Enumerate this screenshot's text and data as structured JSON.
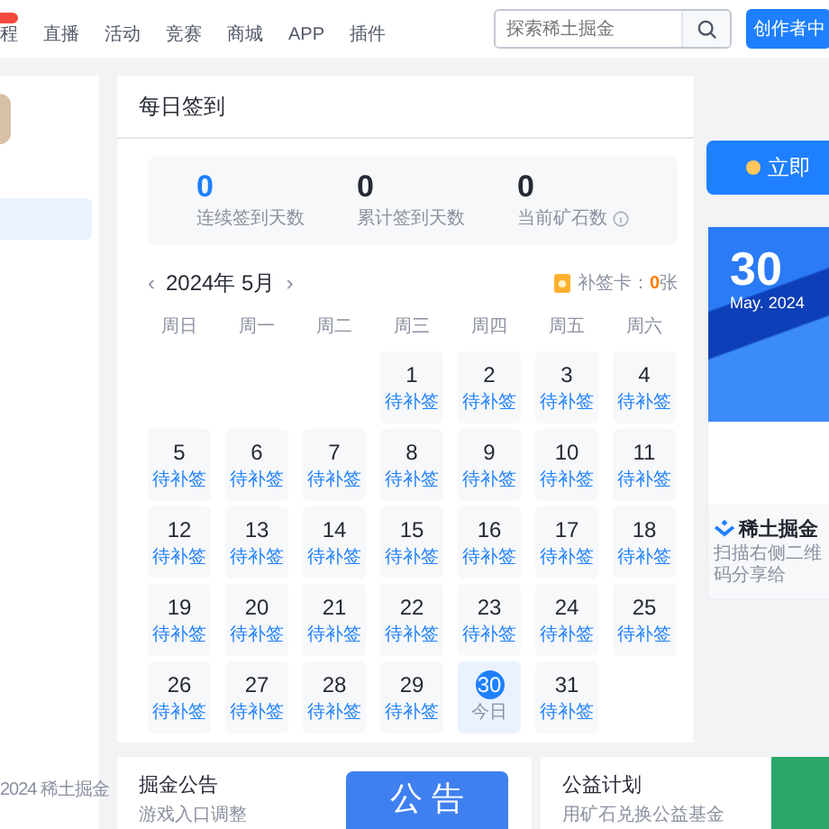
{
  "header": {
    "nav": [
      {
        "label": "程",
        "badge": true
      },
      {
        "label": "直播",
        "badge": false
      },
      {
        "label": "活动",
        "badge": false
      },
      {
        "label": "竞赛",
        "badge": false
      },
      {
        "label": "商城",
        "badge": false
      },
      {
        "label": "APP",
        "badge": false
      },
      {
        "label": "插件",
        "badge": false
      }
    ],
    "search": {
      "placeholder": "探索稀土掘金"
    },
    "creator_button": "创作者中"
  },
  "sidebar": {
    "footer": "2024 稀土掘金"
  },
  "checkin": {
    "title": "每日签到",
    "stats": [
      {
        "value": "0",
        "label": "连续签到天数",
        "highlight": true,
        "info": false
      },
      {
        "value": "0",
        "label": "累计签到天数",
        "highlight": false,
        "info": false
      },
      {
        "value": "0",
        "label": "当前矿石数",
        "highlight": false,
        "info": true
      }
    ],
    "prev": "‹",
    "month": "2024年 5月",
    "next": "›",
    "card_label": "补签卡：",
    "card_count": "0",
    "card_unit": "张",
    "weekdays": [
      "周日",
      "周一",
      "周二",
      "周三",
      "周四",
      "周五",
      "周六"
    ],
    "days": [
      {
        "kind": "blank"
      },
      {
        "kind": "blank"
      },
      {
        "kind": "blank"
      },
      {
        "kind": "day",
        "day": "1",
        "status": "待补签",
        "today": false
      },
      {
        "kind": "day",
        "day": "2",
        "status": "待补签",
        "today": false
      },
      {
        "kind": "day",
        "day": "3",
        "status": "待补签",
        "today": false
      },
      {
        "kind": "day",
        "day": "4",
        "status": "待补签",
        "today": false
      },
      {
        "kind": "day",
        "day": "5",
        "status": "待补签",
        "today": false
      },
      {
        "kind": "day",
        "day": "6",
        "status": "待补签",
        "today": false
      },
      {
        "kind": "day",
        "day": "7",
        "status": "待补签",
        "today": false
      },
      {
        "kind": "day",
        "day": "8",
        "status": "待补签",
        "today": false
      },
      {
        "kind": "day",
        "day": "9",
        "status": "待补签",
        "today": false
      },
      {
        "kind": "day",
        "day": "10",
        "status": "待补签",
        "today": false
      },
      {
        "kind": "day",
        "day": "11",
        "status": "待补签",
        "today": false
      },
      {
        "kind": "day",
        "day": "12",
        "status": "待补签",
        "today": false
      },
      {
        "kind": "day",
        "day": "13",
        "status": "待补签",
        "today": false
      },
      {
        "kind": "day",
        "day": "14",
        "status": "待补签",
        "today": false
      },
      {
        "kind": "day",
        "day": "15",
        "status": "待补签",
        "today": false
      },
      {
        "kind": "day",
        "day": "16",
        "status": "待补签",
        "today": false
      },
      {
        "kind": "day",
        "day": "17",
        "status": "待补签",
        "today": false
      },
      {
        "kind": "day",
        "day": "18",
        "status": "待补签",
        "today": false
      },
      {
        "kind": "day",
        "day": "19",
        "status": "待补签",
        "today": false
      },
      {
        "kind": "day",
        "day": "20",
        "status": "待补签",
        "today": false
      },
      {
        "kind": "day",
        "day": "21",
        "status": "待补签",
        "today": false
      },
      {
        "kind": "day",
        "day": "22",
        "status": "待补签",
        "today": false
      },
      {
        "kind": "day",
        "day": "23",
        "status": "待补签",
        "today": false
      },
      {
        "kind": "day",
        "day": "24",
        "status": "待补签",
        "today": false
      },
      {
        "kind": "day",
        "day": "25",
        "status": "待补签",
        "today": false
      },
      {
        "kind": "day",
        "day": "26",
        "status": "待补签",
        "today": false
      },
      {
        "kind": "day",
        "day": "27",
        "status": "待补签",
        "today": false
      },
      {
        "kind": "day",
        "day": "28",
        "status": "待补签",
        "today": false
      },
      {
        "kind": "day",
        "day": "29",
        "status": "待补签",
        "today": false
      },
      {
        "kind": "day",
        "day": "30",
        "status": "今日",
        "today": true
      },
      {
        "kind": "day",
        "day": "31",
        "status": "待补签",
        "today": false
      }
    ]
  },
  "side_panel": {
    "sign_button": "立即",
    "date_day": "30",
    "date_month": "May. 2024",
    "brand": "稀土掘金",
    "share_hint": "扫描右侧二维码分享给"
  },
  "bottom": [
    {
      "title": "掘金公告",
      "subtitle": "游戏入口调整",
      "banner": "公 告"
    },
    {
      "title": "公益计划",
      "subtitle": "用矿石兑换公益基金"
    }
  ]
}
